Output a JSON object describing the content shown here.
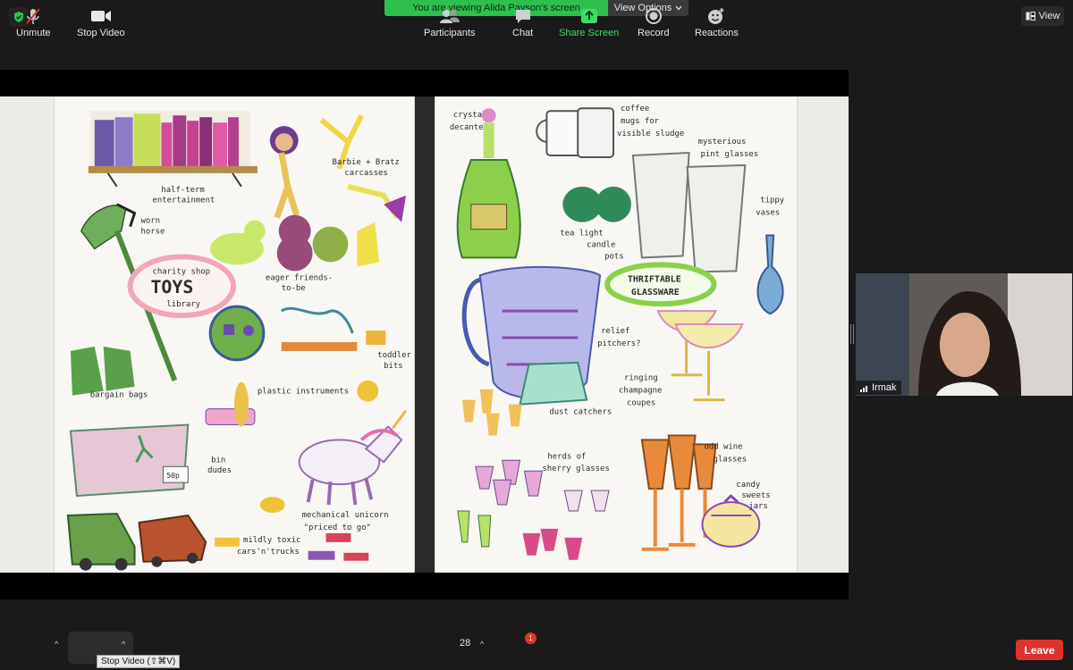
{
  "topbar": {
    "banner_text": "You are viewing Alida Payson's screen",
    "view_options_label": "View Options",
    "view_label": "View"
  },
  "participant_video": {
    "name": "Irmak"
  },
  "left_page": {
    "labels": {
      "half_term": "half-term",
      "entertainment": "entertainment",
      "worn": "worn",
      "horse": "horse",
      "charity_shop": "charity shop",
      "toys": "TOYS",
      "library": "library",
      "barbie": "Barbie + Bratz",
      "carcasses": "carcasses",
      "eager": "eager friends-",
      "to_be": "to-be",
      "toddler": "toddler",
      "bits": "bits",
      "bargain_bags": "bargain bags",
      "plastic_instruments": "plastic instruments",
      "bin": "bin",
      "dudes": "dudes",
      "price_tag": "50p",
      "mechanical_unicorn": "mechanical unicorn",
      "priced_to_go": "\"priced to go\"",
      "mildly_toxic": "mildly toxic",
      "cars_trucks": "cars'n'trucks"
    }
  },
  "right_page": {
    "labels": {
      "crystal": "crystal",
      "decanters": "decanters",
      "coffee": "coffee",
      "mugs_for": "mugs for",
      "visible_sludge": "visible sludge",
      "mysterious": "mysterious",
      "pint_glasses": "pint glasses",
      "tippy": "tippy",
      "vases": "vases",
      "tea_light": "tea light",
      "candle": "candle",
      "pots": "pots",
      "thriftable": "THRIFTABLE",
      "glassware": "GLASSWARE",
      "relief": "relief",
      "pitchers": "pitchers?",
      "ringing": "ringing",
      "champagne": "champagne",
      "coupes": "coupes",
      "dust_catchers": "dust catchers",
      "herds_of": "herds of",
      "sherry_glasses": "sherry glasses",
      "odd_wine": "odd wine",
      "glasses": "glasses",
      "candy": "candy",
      "sweets": "sweets",
      "jars": "jars"
    }
  },
  "toolbar": {
    "unmute_label": "Unmute",
    "stop_video_label": "Stop Video",
    "stop_video_tooltip": "Stop Video (⇧⌘V)",
    "participants_label": "Participants",
    "participants_count": "28",
    "chat_label": "Chat",
    "chat_badge": "1",
    "share_screen_label": "Share Screen",
    "record_label": "Record",
    "reactions_label": "Reactions",
    "leave_label": "Leave"
  },
  "colors": {
    "background": "#1a1a1a",
    "banner_green": "#2fbf4f",
    "leave_red": "#e0322c",
    "share_green": "#3ddc65"
  },
  "icons": [
    "shield-check-icon",
    "chevron-down-icon",
    "grid-view-icon",
    "muted-mic-icon",
    "video-camera-icon",
    "participants-icon",
    "chat-icon",
    "share-screen-icon",
    "record-icon",
    "reactions-icon",
    "signal-icon"
  ]
}
